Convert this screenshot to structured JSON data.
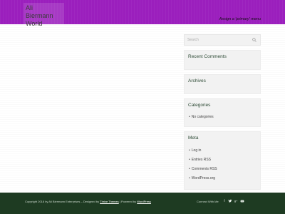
{
  "header": {
    "site_title": "Ali Biermann World",
    "menu_notice": "Assign a 'primary' menu"
  },
  "search": {
    "placeholder": "Search"
  },
  "widgets": {
    "recent_comments": {
      "title": "Recent Comments"
    },
    "archives": {
      "title": "Archives"
    },
    "categories": {
      "title": "Categories",
      "items": [
        "No categories"
      ]
    },
    "meta": {
      "title": "Meta",
      "items": [
        "Log in",
        "Entries RSS",
        "Comments RSS",
        "WordPress.org"
      ]
    }
  },
  "footer": {
    "copyright": "Copyright 2018 by Ali Biermann Enterprises",
    "designed_by_prefix": "– Designed by",
    "designer_link": "Thrive Themes",
    "powered_by_prefix": "| Powered by",
    "powered_link": "WordPress",
    "connect_label": "Connect With Me",
    "social_icons": [
      "facebook-icon",
      "twitter-icon",
      "google-plus-icon",
      "youtube-icon"
    ]
  },
  "colors": {
    "header_bg": "#9b1fbd",
    "footer_bg": "#1e3b22",
    "widget_bg": "#f2f2f2",
    "widget_title": "#2d4a35"
  }
}
